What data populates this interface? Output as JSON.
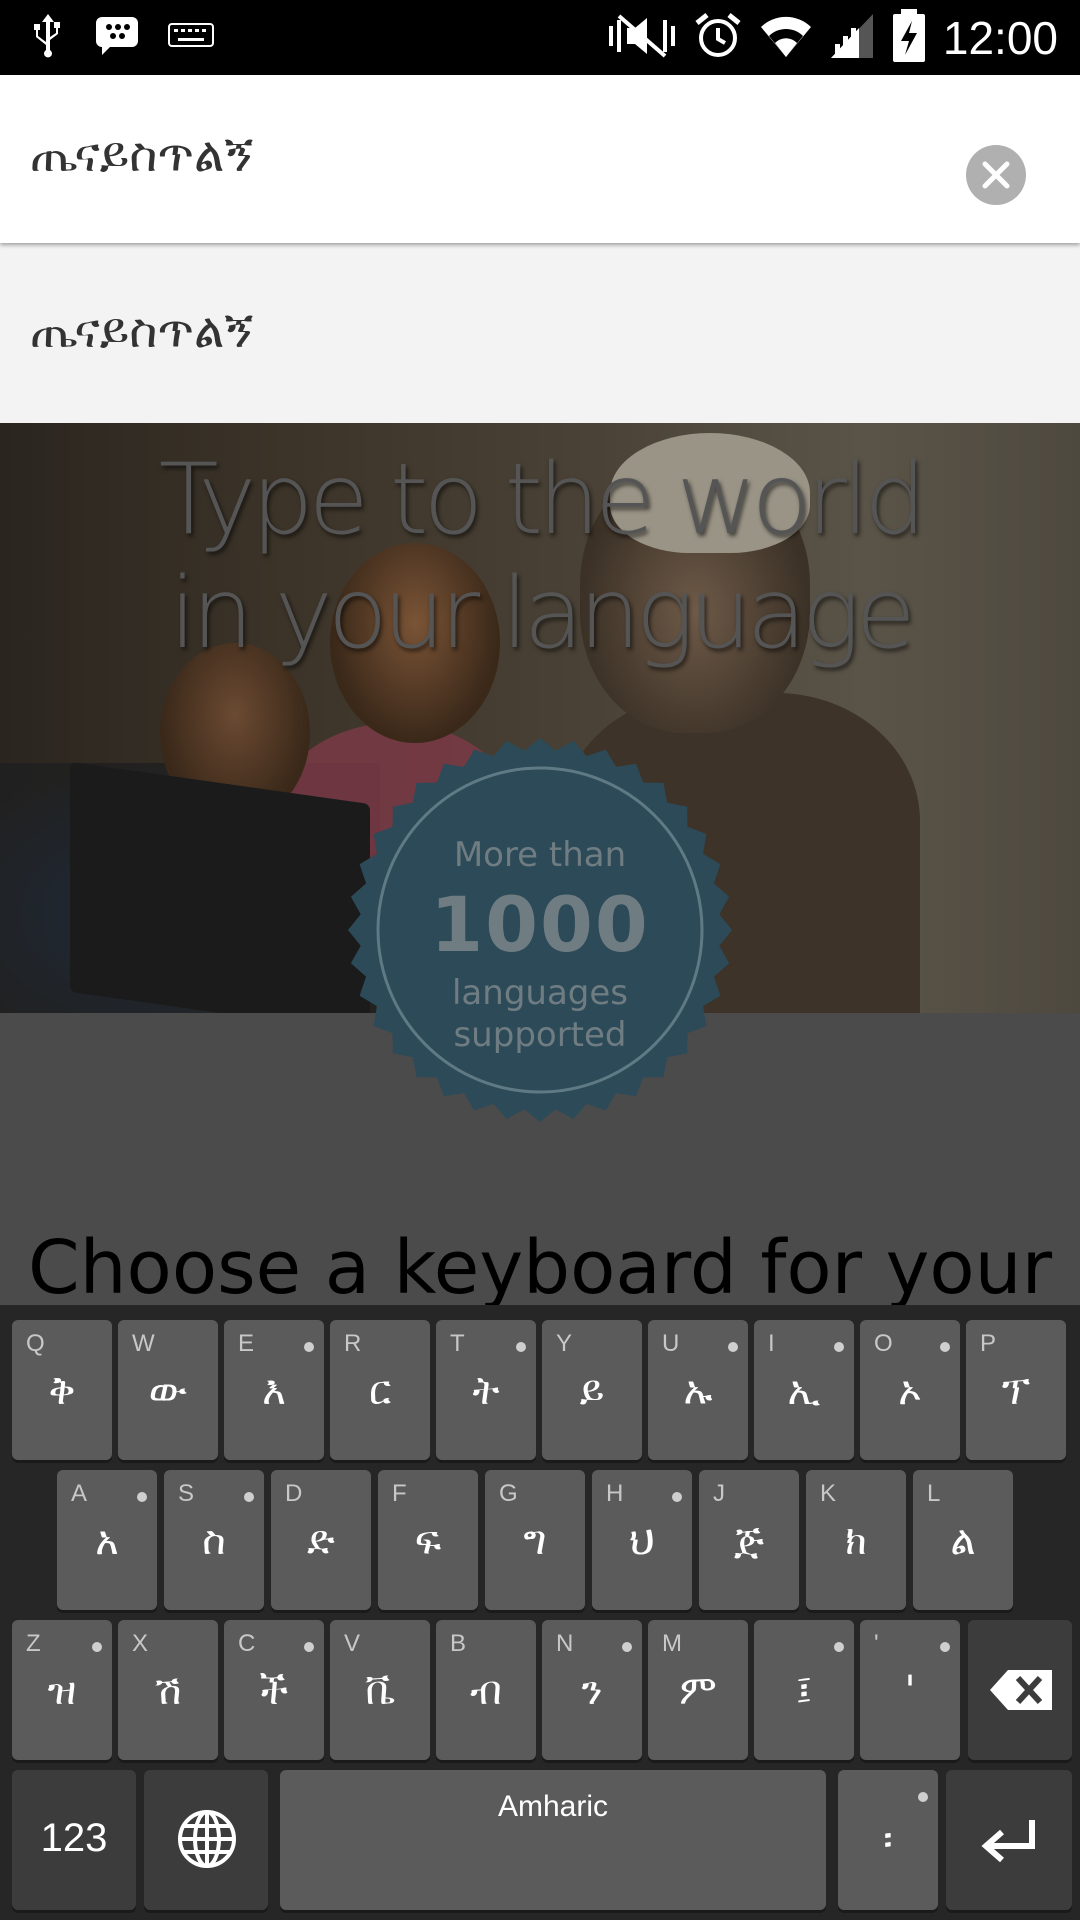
{
  "status_bar": {
    "time": "12:00",
    "icons": [
      "usb-icon",
      "bbm-icon",
      "keyboard-icon",
      "mute-icon",
      "alarm-icon",
      "wifi-icon",
      "signal-icon",
      "battery-charging-icon"
    ]
  },
  "search": {
    "query": "ጤናይስጥልኝ",
    "clear_icon": "close-icon"
  },
  "suggestion": {
    "text": "ጤናይስጥልኝ"
  },
  "hero": {
    "title_line1": "Type to the world",
    "title_line2": "in your language"
  },
  "badge": {
    "line1": "More than",
    "line2": "1000",
    "line3": "languages",
    "line4": "supported"
  },
  "choose_text": "Choose a keyboard for your",
  "keyboard": {
    "row1": [
      {
        "hint": "Q",
        "glyph": "ቅ",
        "dot": false
      },
      {
        "hint": "W",
        "glyph": "ው",
        "dot": false
      },
      {
        "hint": "E",
        "glyph": "እ",
        "dot": true
      },
      {
        "hint": "R",
        "glyph": "ር",
        "dot": false
      },
      {
        "hint": "T",
        "glyph": "ት",
        "dot": true
      },
      {
        "hint": "Y",
        "glyph": "ይ",
        "dot": false
      },
      {
        "hint": "U",
        "glyph": "ኡ",
        "dot": true
      },
      {
        "hint": "I",
        "glyph": "ኢ",
        "dot": true
      },
      {
        "hint": "O",
        "glyph": "ኦ",
        "dot": true
      },
      {
        "hint": "P",
        "glyph": "ፕ",
        "dot": false
      }
    ],
    "row2": [
      {
        "hint": "A",
        "glyph": "አ",
        "dot": true
      },
      {
        "hint": "S",
        "glyph": "ስ",
        "dot": true
      },
      {
        "hint": "D",
        "glyph": "ድ",
        "dot": false
      },
      {
        "hint": "F",
        "glyph": "ፍ",
        "dot": false
      },
      {
        "hint": "G",
        "glyph": "ግ",
        "dot": false
      },
      {
        "hint": "H",
        "glyph": "ህ",
        "dot": true
      },
      {
        "hint": "J",
        "glyph": "ጅ",
        "dot": false
      },
      {
        "hint": "K",
        "glyph": "ክ",
        "dot": false
      },
      {
        "hint": "L",
        "glyph": "ል",
        "dot": false
      }
    ],
    "row3": [
      {
        "hint": "Z",
        "glyph": "ዝ",
        "dot": true
      },
      {
        "hint": "X",
        "glyph": "ሽ",
        "dot": false
      },
      {
        "hint": "C",
        "glyph": "ች",
        "dot": true
      },
      {
        "hint": "V",
        "glyph": "ቬ",
        "dot": false
      },
      {
        "hint": "B",
        "glyph": "ብ",
        "dot": false
      },
      {
        "hint": "N",
        "glyph": "ን",
        "dot": true
      },
      {
        "hint": "M",
        "glyph": "ም",
        "dot": false
      },
      {
        "hint": "",
        "glyph": "፤",
        "dot": true
      },
      {
        "hint": "'",
        "glyph": "'",
        "dot": true
      }
    ],
    "numbers_label": "123",
    "space_label": "Amharic",
    "punct_label": "፡",
    "backspace_icon": "backspace-icon",
    "globe_icon": "globe-icon",
    "enter_icon": "enter-icon"
  }
}
